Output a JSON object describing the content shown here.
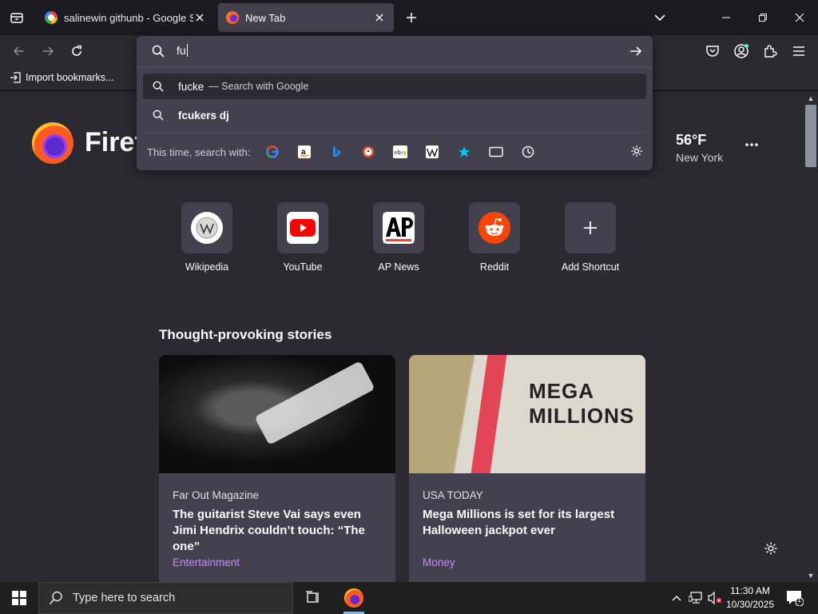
{
  "tabs": [
    {
      "title": "salinewin githunb - Google Sear",
      "favicon": "google-icon"
    },
    {
      "title": "New Tab",
      "favicon": "firefox-icon"
    }
  ],
  "bookmarks": {
    "import_label": "Import bookmarks..."
  },
  "urlbar": {
    "typed": "fu",
    "suggestions": [
      {
        "text": "fucke",
        "sub": "— Search with Google"
      },
      {
        "text": "fcukers dj",
        "sub": ""
      }
    ],
    "search_with_label": "This time, search with:",
    "engines": [
      "Google",
      "Amazon",
      "Bing",
      "DuckDuckGo",
      "eBay",
      "Wikipedia",
      "Bookmarks",
      "Tabs",
      "History"
    ]
  },
  "newtab": {
    "brand": "Firef",
    "weather": {
      "temp": "56°F",
      "city": "New York"
    },
    "shortcuts": [
      {
        "label": "Wikipedia"
      },
      {
        "label": "YouTube"
      },
      {
        "label": "AP News"
      },
      {
        "label": "Reddit"
      },
      {
        "label": "Add Shortcut"
      }
    ],
    "stories_heading": "Thought-provoking stories",
    "stories": [
      {
        "source": "Far Out Magazine",
        "headline": "The guitarist Steve Vai says even Jimi Hendrix couldn’t touch: “The one”",
        "category": "Entertainment"
      },
      {
        "source": "USA TODAY",
        "headline": "Mega Millions is set for its largest Halloween jackpot ever",
        "category": "Money",
        "image_text": "MEGA MILLIONS"
      }
    ]
  },
  "taskbar": {
    "search_placeholder": "Type here to search",
    "time": "11:30 AM",
    "date": "10/30/2025",
    "notifications": "1"
  },
  "colors": {
    "accent": "#c38cff",
    "tab_active": "#42414d",
    "toolbar": "#2b2a33",
    "tabstrip": "#1c1b22"
  }
}
